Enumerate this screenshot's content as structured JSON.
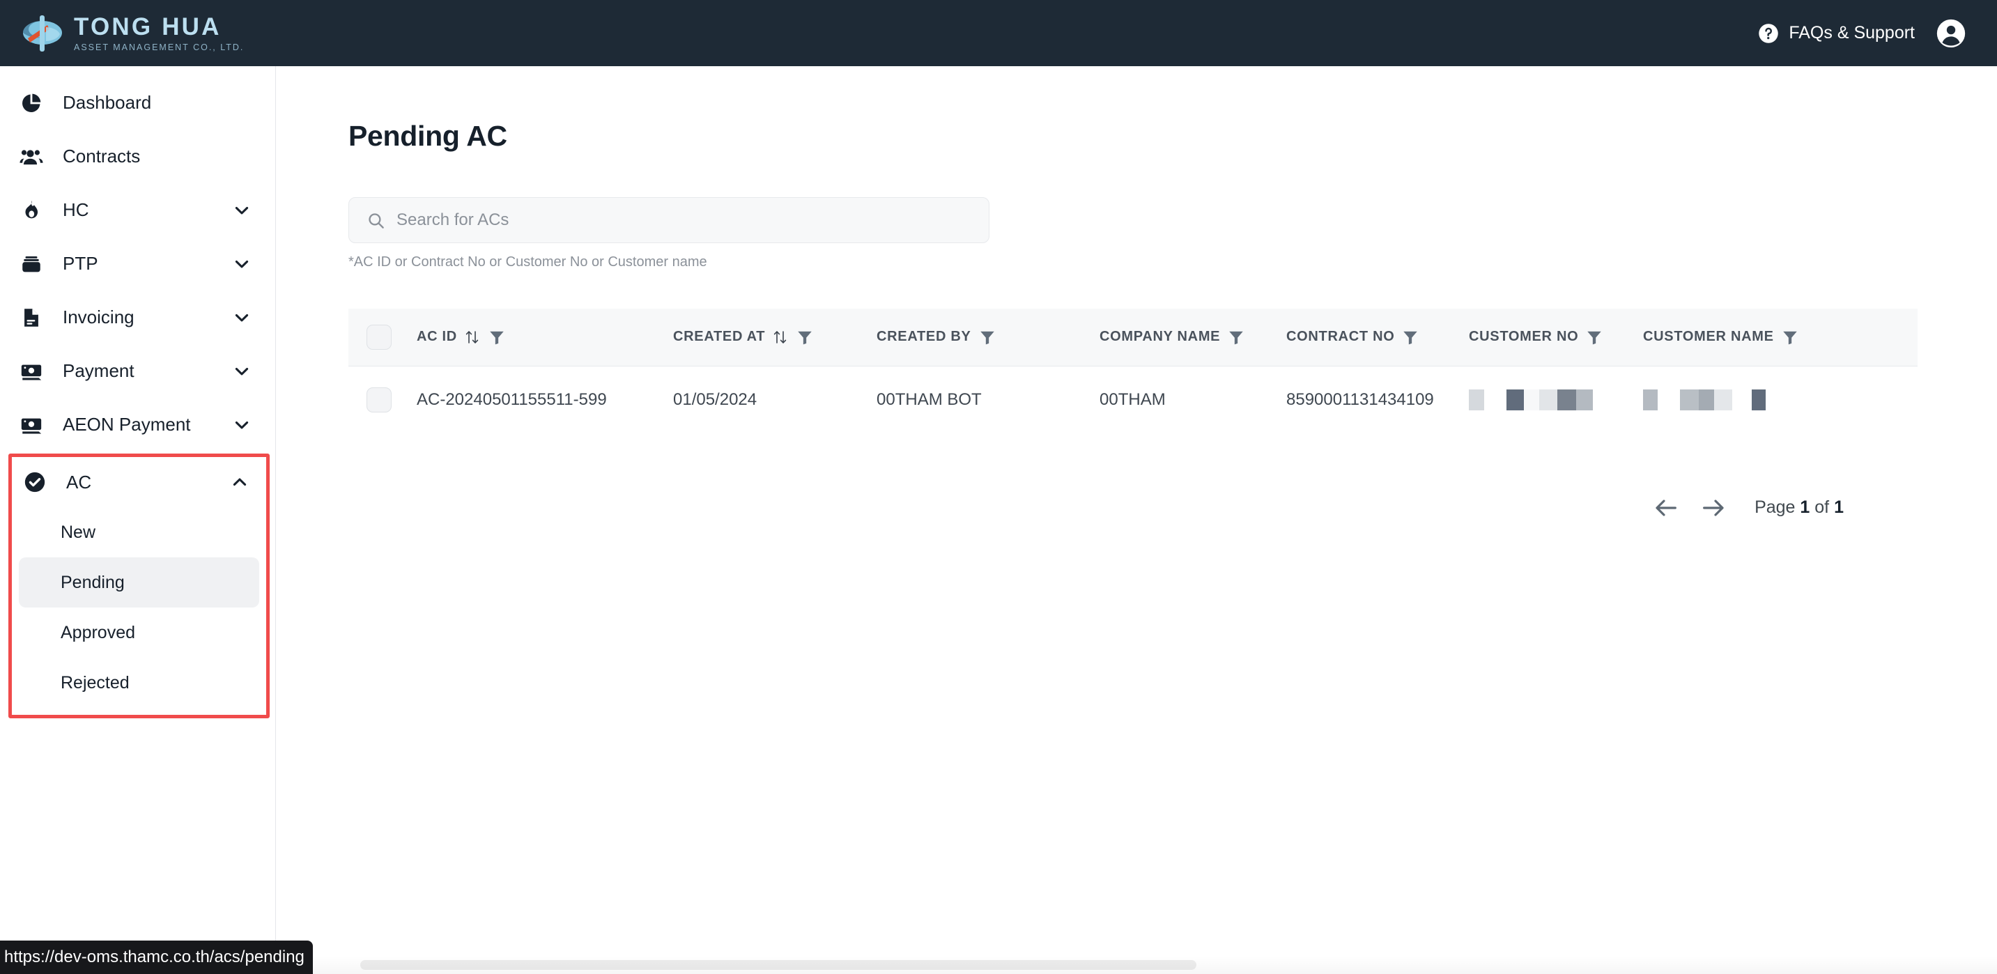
{
  "header": {
    "brand_name": "TONG HUA",
    "brand_sub": "ASSET MANAGEMENT CO., LTD.",
    "faq_label": "FAQs & Support",
    "bg_color": "#1e2a36",
    "brand_color": "#bcdff0"
  },
  "sidebar": {
    "items": [
      {
        "label": "Dashboard",
        "icon": "pie-chart-icon",
        "expandable": false
      },
      {
        "label": "Contracts",
        "icon": "people-icon",
        "expandable": false
      },
      {
        "label": "HC",
        "icon": "flame-icon",
        "expandable": true,
        "chevron": "chevron-down-icon"
      },
      {
        "label": "PTP",
        "icon": "wallet-icon",
        "expandable": true,
        "chevron": "chevron-down-icon"
      },
      {
        "label": "Invoicing",
        "icon": "document-icon",
        "expandable": true,
        "chevron": "chevron-down-icon"
      },
      {
        "label": "Payment",
        "icon": "banknote-icon",
        "expandable": true,
        "chevron": "chevron-down-icon"
      },
      {
        "label": "AEON Payment",
        "icon": "banknote-icon",
        "expandable": true,
        "chevron": "chevron-down-icon"
      }
    ],
    "ac_group": {
      "label": "AC",
      "icon": "check-circle-icon",
      "chevron": "chevron-up-icon",
      "highlight_color": "#f04b4b",
      "sub_items": [
        {
          "label": "New",
          "active": false
        },
        {
          "label": "Pending",
          "active": true
        },
        {
          "label": "Approved",
          "active": false
        },
        {
          "label": "Rejected",
          "active": false
        }
      ]
    }
  },
  "main": {
    "page_title": "Pending AC",
    "search": {
      "placeholder": "Search for ACs",
      "value": "",
      "hint": "*AC ID or Contract No or Customer No or Customer name"
    },
    "table": {
      "columns": [
        {
          "label": "AC ID",
          "sortable": true,
          "filterable": true
        },
        {
          "label": "CREATED AT",
          "sortable": true,
          "filterable": true
        },
        {
          "label": "CREATED BY",
          "sortable": false,
          "filterable": true
        },
        {
          "label": "COMPANY NAME",
          "sortable": false,
          "filterable": true
        },
        {
          "label": "CONTRACT NO",
          "sortable": false,
          "filterable": true
        },
        {
          "label": "CUSTOMER NO",
          "sortable": false,
          "filterable": true
        },
        {
          "label": "CUSTOMER NAME",
          "sortable": false,
          "filterable": true
        }
      ],
      "rows": [
        {
          "selected": false,
          "ac_id": "AC-20240501155511-599",
          "created_at": "01/05/2024",
          "created_by": "00THAM BOT",
          "company_name": "00THAM",
          "contract_no": "8590001131434109",
          "customer_no": "",
          "customer_name": ""
        }
      ]
    },
    "pagination": {
      "prev_icon": "arrow-left-icon",
      "next_icon": "arrow-right-icon",
      "label_prefix": "Page",
      "current_page": "1",
      "label_middle": "of",
      "total_pages": "1"
    }
  },
  "statusbar": {
    "url": "https://dev-oms.thamc.co.th/acs/pending"
  }
}
